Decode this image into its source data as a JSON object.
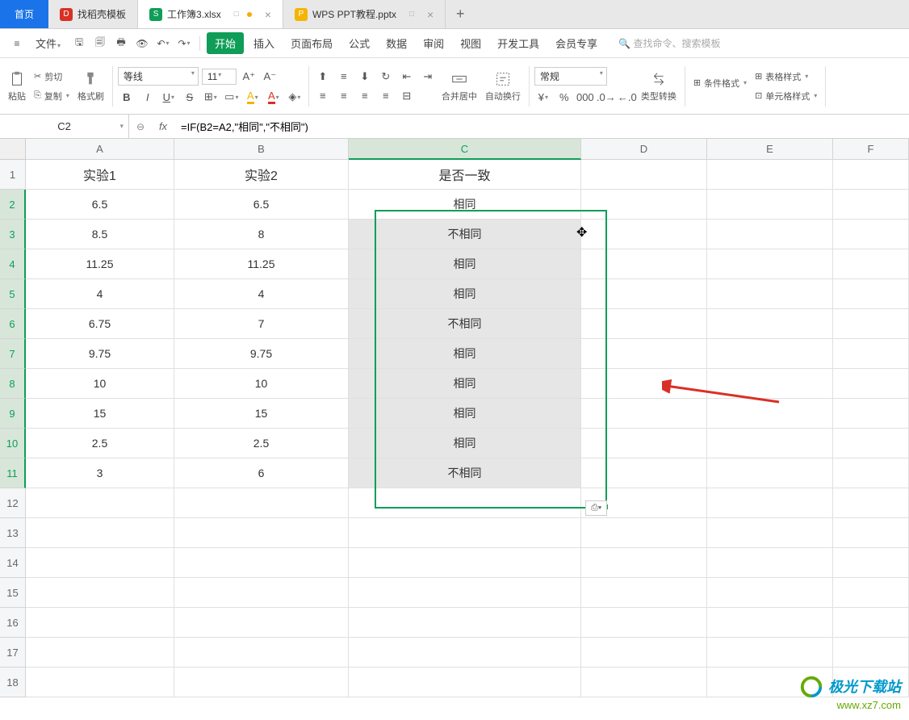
{
  "tabs": {
    "home": "首页",
    "items": [
      {
        "icon": "red",
        "iconChar": "D",
        "label": "找稻壳模板"
      },
      {
        "icon": "green",
        "iconChar": "S",
        "label": "工作簿3.xlsx",
        "active": true,
        "status": "□",
        "dot": true
      },
      {
        "icon": "orange",
        "iconChar": "P",
        "label": "WPS PPT教程.pptx",
        "status": "□"
      }
    ]
  },
  "menu": {
    "file": "文件",
    "items": [
      "开始",
      "插入",
      "页面布局",
      "公式",
      "数据",
      "审阅",
      "视图",
      "开发工具",
      "会员专享"
    ],
    "search_placeholder": "查找命令、搜索模板"
  },
  "ribbon": {
    "paste": "粘贴",
    "cut": "剪切",
    "copy": "复制",
    "format_painter": "格式刷",
    "font_name": "等线",
    "font_size": "11",
    "merge_center": "合并居中",
    "auto_wrap": "自动换行",
    "number_format": "常规",
    "type_conv": "类型转换",
    "cond_fmt": "条件格式",
    "table_style": "表格样式",
    "cell_style": "单元格样式"
  },
  "formula_bar": {
    "name_box": "C2",
    "formula": "=IF(B2=A2,\"相同\",\"不相同\")"
  },
  "columns": [
    "A",
    "B",
    "C",
    "D",
    "E",
    "F"
  ],
  "headers": {
    "a": "实验1",
    "b": "实验2",
    "c": "是否一致"
  },
  "rows": [
    {
      "a": "6.5",
      "b": "6.5",
      "c": "相同"
    },
    {
      "a": "8.5",
      "b": "8",
      "c": "不相同"
    },
    {
      "a": "11.25",
      "b": "11.25",
      "c": "相同"
    },
    {
      "a": "4",
      "b": "4",
      "c": "相同"
    },
    {
      "a": "6.75",
      "b": "7",
      "c": "不相同"
    },
    {
      "a": "9.75",
      "b": "9.75",
      "c": "相同"
    },
    {
      "a": "10",
      "b": "10",
      "c": "相同"
    },
    {
      "a": "15",
      "b": "15",
      "c": "相同"
    },
    {
      "a": "2.5",
      "b": "2.5",
      "c": "相同"
    },
    {
      "a": "3",
      "b": "6",
      "c": "不相同"
    }
  ],
  "row_nums": [
    "1",
    "2",
    "3",
    "4",
    "5",
    "6",
    "7",
    "8",
    "9",
    "10",
    "11",
    "12",
    "13",
    "14",
    "15",
    "16",
    "17",
    "18"
  ],
  "paste_opt": "⎙▾",
  "watermark": {
    "text": "极光下载站",
    "url": "www.xz7.com"
  }
}
